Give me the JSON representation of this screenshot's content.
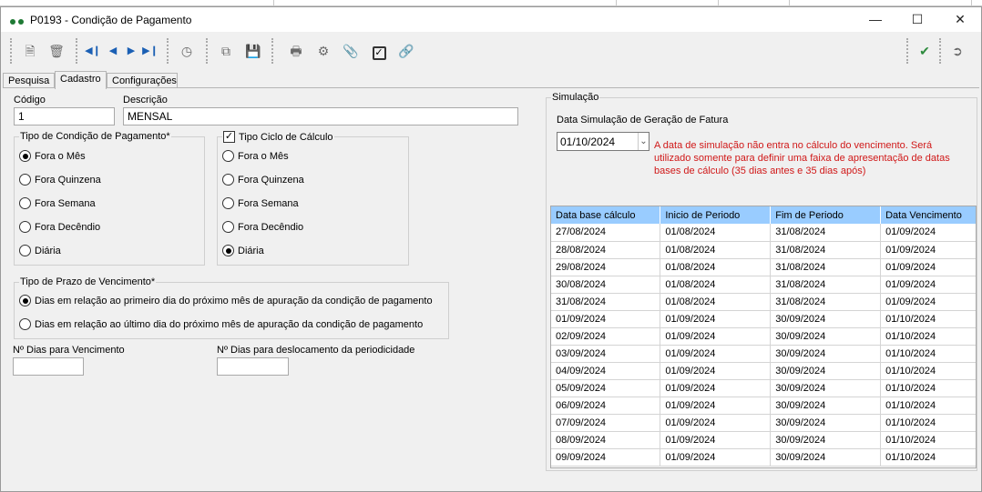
{
  "window": {
    "title": "P0193 - Condição de Pagamento",
    "minimize_icon": "minimize-icon",
    "maximize_icon": "maximize-icon",
    "close_icon": "close-icon"
  },
  "toolbar": {
    "icons": [
      "new-document-icon",
      "delete-icon",
      "first-record-icon",
      "previous-record-icon",
      "next-record-icon",
      "last-record-icon",
      "history-icon",
      "copy-icon",
      "save-icon",
      "print-icon",
      "settings-icon",
      "attach-icon",
      "checkbox-icon",
      "link-icon",
      "confirm-icon",
      "exit-icon"
    ],
    "accent_color": "#1a5fb4",
    "confirm_color": "#2e8b3e"
  },
  "tabs": [
    "Pesquisa",
    "Cadastro",
    "Configurações"
  ],
  "form": {
    "codigo_label": "Código",
    "codigo_value": "1",
    "descricao_label": "Descrição",
    "descricao_value": "MENSAL",
    "tipo_condicao": {
      "legend": "Tipo de Condição de Pagamento*",
      "options": [
        "Fora o Mês",
        "Fora Quinzena",
        "Fora Semana",
        "Fora Decêndio",
        "Diária"
      ],
      "selected": "Fora o Mês"
    },
    "tipo_ciclo": {
      "legend": "Tipo Ciclo de Cálculo",
      "checked": true,
      "options": [
        "Fora o Mês",
        "Fora Quinzena",
        "Fora Semana",
        "Fora Decêndio",
        "Diária"
      ],
      "selected": "Diária"
    },
    "tipo_prazo": {
      "legend": "Tipo de Prazo de Vencimento*",
      "options": [
        "Dias em relação ao primeiro dia do próximo mês de apuração da condição de pagamento",
        "Dias em relação ao último dia do próximo mês de apuração da condição de pagamento"
      ],
      "selected": "Dias em relação ao primeiro dia do próximo mês de apuração da condição de pagamento"
    },
    "dias_vencimento_label": "Nº Dias para Vencimento",
    "dias_vencimento_value": "",
    "dias_deslocamento_label": "Nº Dias para deslocamento da periodicidade",
    "dias_deslocamento_value": ""
  },
  "simulacao": {
    "legend": "Simulação",
    "data_label": "Data Simulação de Geração de Fatura",
    "data_value": "01/10/2024",
    "note": "A data de simulação não entra no cálculo do vencimento. Será utilizado somente para definir uma faixa de apresentação de datas bases de cálculo (35 dias antes e 35 dias após)",
    "note_color": "#d01818",
    "header_color": "#99ccff",
    "columns": [
      "Data base cálculo",
      "Inicio de Periodo",
      "Fim de Periodo",
      "Data Vencimento"
    ],
    "rows": [
      [
        "27/08/2024",
        "01/08/2024",
        "31/08/2024",
        "01/09/2024"
      ],
      [
        "28/08/2024",
        "01/08/2024",
        "31/08/2024",
        "01/09/2024"
      ],
      [
        "29/08/2024",
        "01/08/2024",
        "31/08/2024",
        "01/09/2024"
      ],
      [
        "30/08/2024",
        "01/08/2024",
        "31/08/2024",
        "01/09/2024"
      ],
      [
        "31/08/2024",
        "01/08/2024",
        "31/08/2024",
        "01/09/2024"
      ],
      [
        "01/09/2024",
        "01/09/2024",
        "30/09/2024",
        "01/10/2024"
      ],
      [
        "02/09/2024",
        "01/09/2024",
        "30/09/2024",
        "01/10/2024"
      ],
      [
        "03/09/2024",
        "01/09/2024",
        "30/09/2024",
        "01/10/2024"
      ],
      [
        "04/09/2024",
        "01/09/2024",
        "30/09/2024",
        "01/10/2024"
      ],
      [
        "05/09/2024",
        "01/09/2024",
        "30/09/2024",
        "01/10/2024"
      ],
      [
        "06/09/2024",
        "01/09/2024",
        "30/09/2024",
        "01/10/2024"
      ],
      [
        "07/09/2024",
        "01/09/2024",
        "30/09/2024",
        "01/10/2024"
      ],
      [
        "08/09/2024",
        "01/09/2024",
        "30/09/2024",
        "01/10/2024"
      ],
      [
        "09/09/2024",
        "01/09/2024",
        "30/09/2024",
        "01/10/2024"
      ]
    ]
  }
}
